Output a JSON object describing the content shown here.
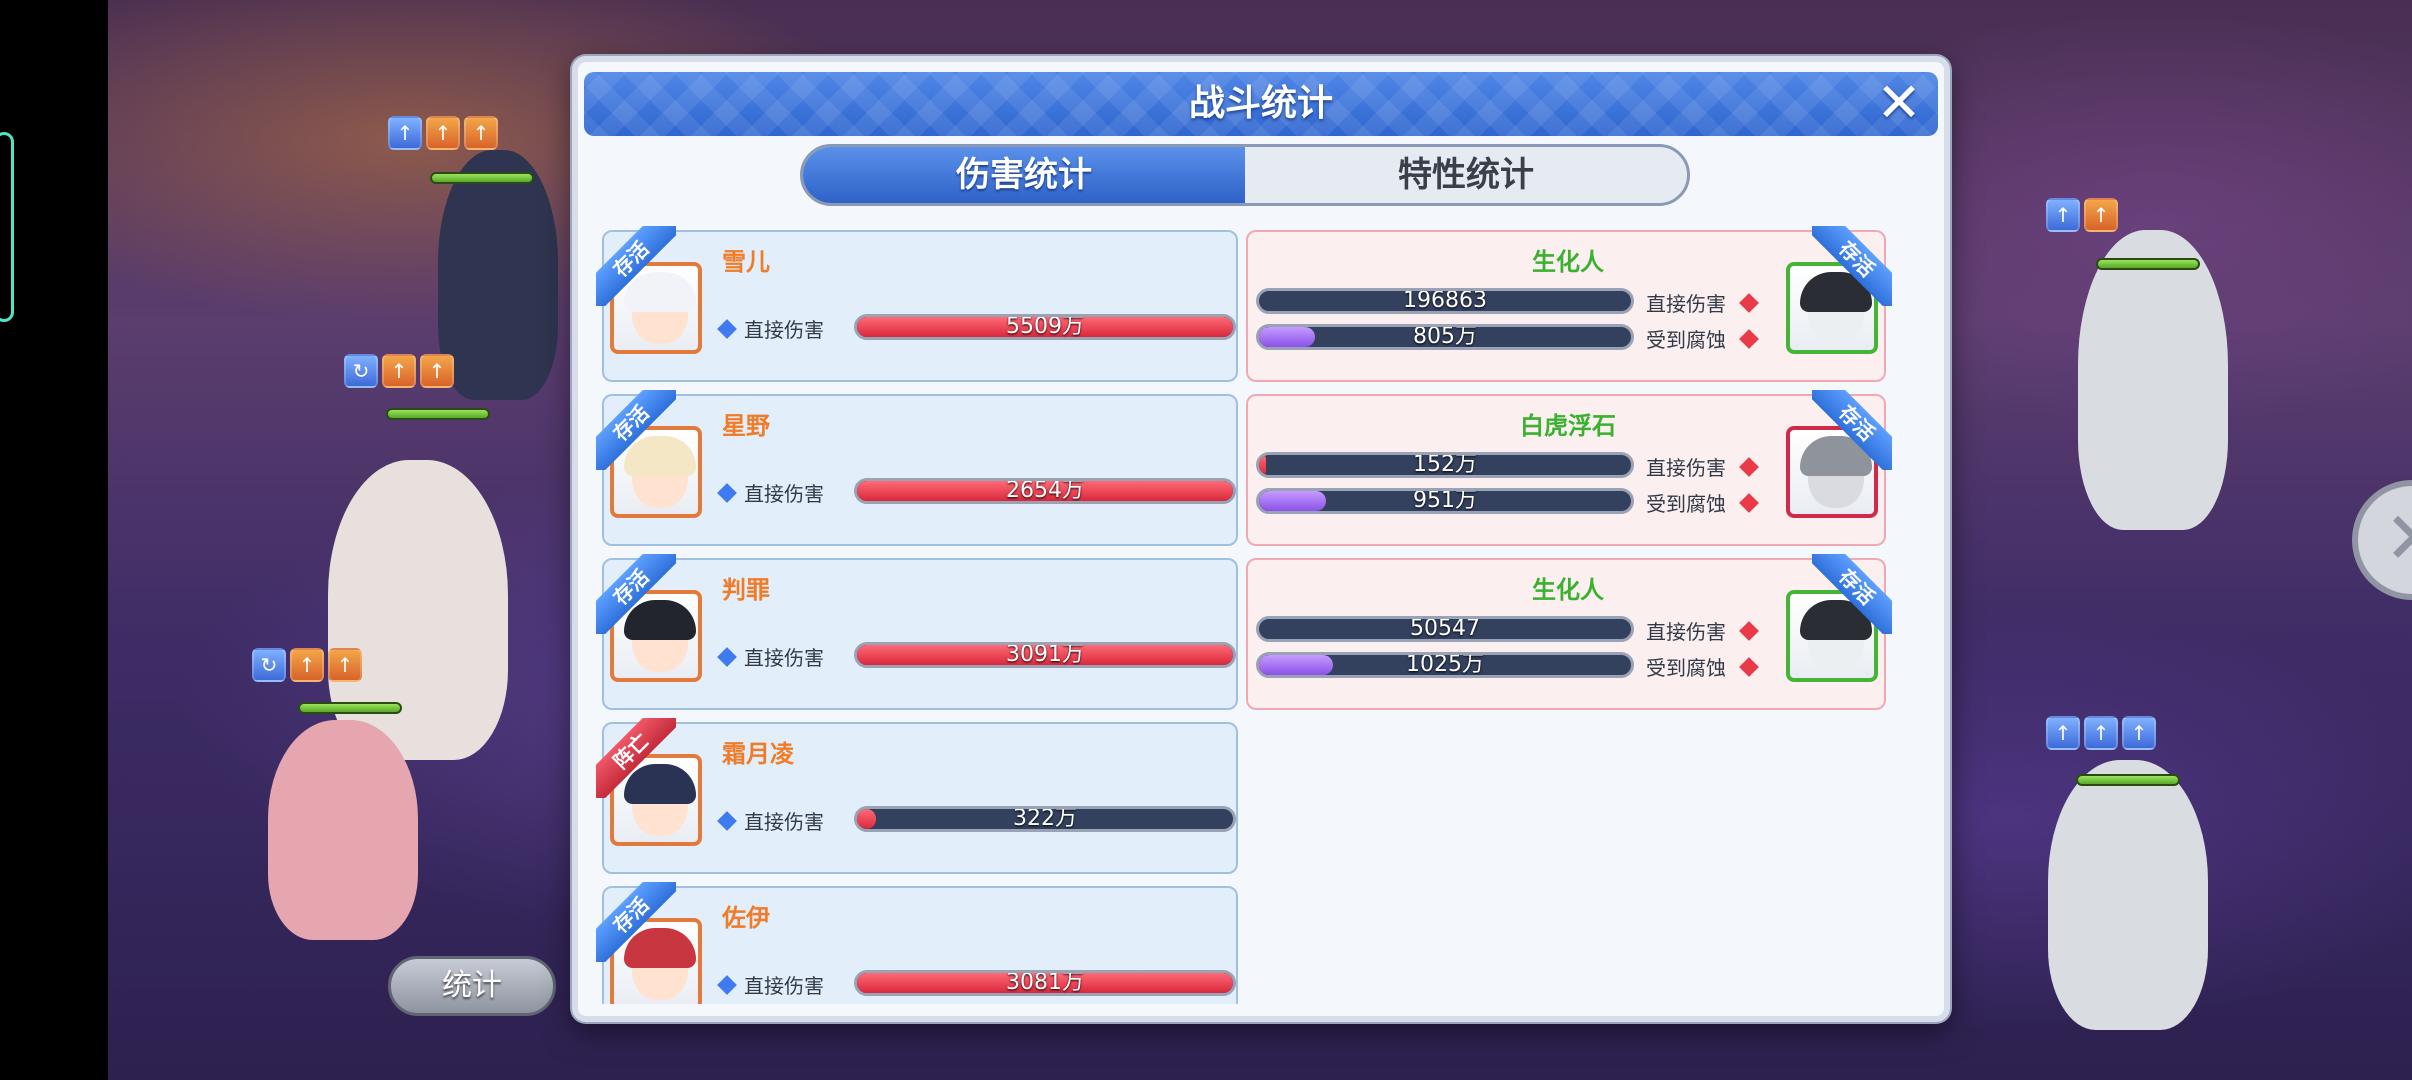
{
  "dialog": {
    "title": "战斗统计",
    "close_icon": "close-icon"
  },
  "tabs": [
    {
      "label": "伤害统计",
      "active": true
    },
    {
      "label": "特性统计",
      "active": false
    }
  ],
  "allies": [
    {
      "name": "雪儿",
      "status": "存活",
      "stat_label": "直接伤害",
      "value": "5509万",
      "fill": 1.0
    },
    {
      "name": "星野",
      "status": "存活",
      "stat_label": "直接伤害",
      "value": "2654万",
      "fill": 1.0
    },
    {
      "name": "判罪",
      "status": "存活",
      "stat_label": "直接伤害",
      "value": "3091万",
      "fill": 1.0
    },
    {
      "name": "霜月凌",
      "status": "阵亡",
      "stat_label": "直接伤害",
      "value": "322万",
      "fill": 0.05
    },
    {
      "name": "佐伊",
      "status": "存活",
      "stat_label": "直接伤害",
      "value": "3081万",
      "fill": 1.0
    }
  ],
  "enemies": [
    {
      "name": "生化人",
      "status": "存活",
      "frame": "green",
      "stats": [
        {
          "label": "直接伤害",
          "value": "196863",
          "fill": 0.0,
          "color": "red"
        },
        {
          "label": "受到腐蚀",
          "value": "805万",
          "fill": 0.15,
          "color": "purple"
        }
      ]
    },
    {
      "name": "白虎浮石",
      "status": "存活",
      "frame": "crimson",
      "stats": [
        {
          "label": "直接伤害",
          "value": "152万",
          "fill": 0.02,
          "color": "red"
        },
        {
          "label": "受到腐蚀",
          "value": "951万",
          "fill": 0.18,
          "color": "purple"
        }
      ]
    },
    {
      "name": "生化人",
      "status": "存活",
      "frame": "green",
      "stats": [
        {
          "label": "直接伤害",
          "value": "50547",
          "fill": 0.0,
          "color": "red"
        },
        {
          "label": "受到腐蚀",
          "value": "1025万",
          "fill": 0.2,
          "color": "purple"
        }
      ]
    }
  ],
  "background": {
    "stat_button_label": "统计"
  },
  "colors": {
    "header_blue": "#2f66cf",
    "ally_name": "#f07c2a",
    "enemy_name": "#3bb22f",
    "alive_ribbon": "#2e70da",
    "dead_ribbon": "#c42b3a"
  }
}
